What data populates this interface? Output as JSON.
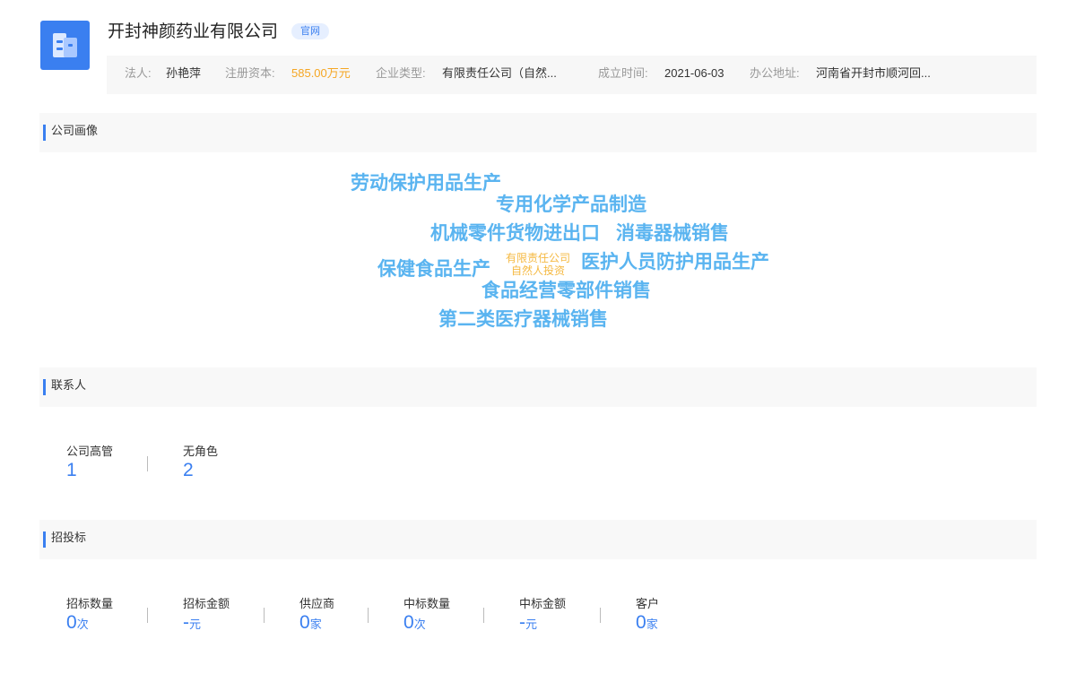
{
  "company": {
    "logo_icon": "building-icon",
    "name": "开封神颜药业有限公司",
    "badge": "官网"
  },
  "info": {
    "legal_label": "法人:",
    "legal_value": "孙艳萍",
    "capital_label": "注册资本:",
    "capital_value": "585.00万元",
    "type_label": "企业类型:",
    "type_value": "有限责任公司（自然...",
    "date_label": "成立时间:",
    "date_value": "2021-06-03",
    "address_label": "办公地址:",
    "address_value": "河南省开封市顺河回..."
  },
  "portrait": {
    "title": "公司画像",
    "tags": [
      "劳动保护用品生产",
      "专用化学产品制造",
      "机械零件货物进出口",
      "消毒器械销售",
      "保健食品生产",
      "医护人员防护用品生产",
      "食品经营零部件销售",
      "第二类医疗器械销售"
    ],
    "small_tag_line1": "有限责任公司",
    "small_tag_line2": "自然人投资"
  },
  "contacts": {
    "title": "联系人",
    "stats": [
      {
        "label": "公司高管",
        "value": "1"
      },
      {
        "label": "无角色",
        "value": "2"
      }
    ]
  },
  "bidding": {
    "title": "招投标",
    "stats": [
      {
        "label": "招标数量",
        "value": "0",
        "unit": "次"
      },
      {
        "label": "招标金额",
        "value": "-",
        "unit": "元"
      },
      {
        "label": "供应商",
        "value": "0",
        "unit": "家"
      },
      {
        "label": "中标数量",
        "value": "0",
        "unit": "次"
      },
      {
        "label": "中标金额",
        "value": "-",
        "unit": "元"
      },
      {
        "label": "客户",
        "value": "0",
        "unit": "家"
      }
    ]
  },
  "colors": {
    "accent": "#3a7ff0",
    "tag_blue": "#5ab4f0",
    "tag_orange": "#f5b942",
    "capital_orange": "#f5a623"
  }
}
